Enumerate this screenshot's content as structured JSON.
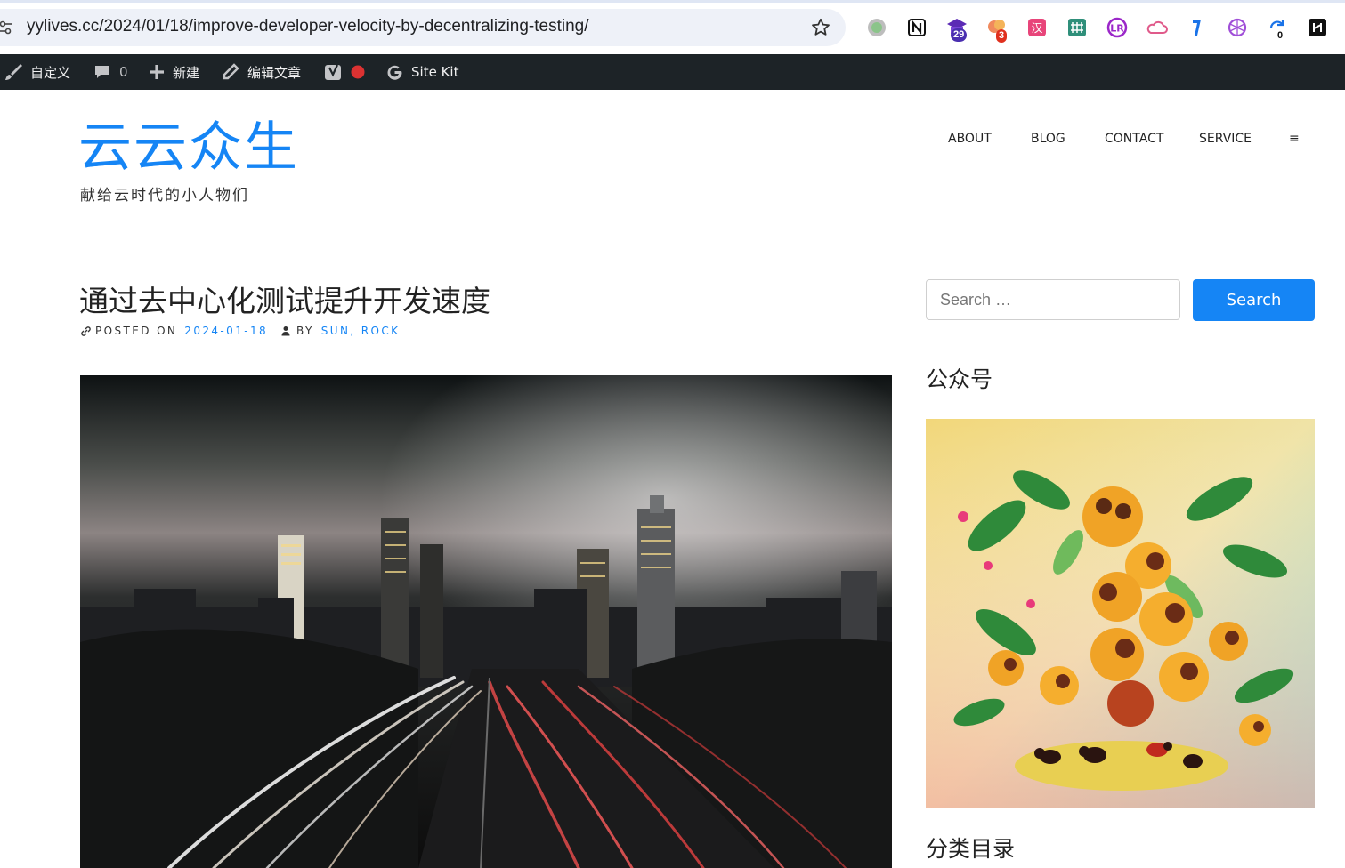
{
  "browser": {
    "url": "yylives.cc/2024/01/18/improve-developer-velocity-by-decentralizing-testing/",
    "extensions": [
      {
        "icon": "circle-extension-icon",
        "badge": ""
      },
      {
        "icon": "notion-icon",
        "badge": ""
      },
      {
        "icon": "graduation-cap-extension-icon",
        "badge": "29"
      },
      {
        "icon": "cloud-extension-icon",
        "badge": "3"
      },
      {
        "icon": "translate-extension-icon",
        "badge": ""
      },
      {
        "icon": "grid-extension-icon",
        "badge": ""
      },
      {
        "icon": "lr-extension-icon",
        "badge": ""
      },
      {
        "icon": "cloud-outline-extension-icon",
        "badge": ""
      },
      {
        "icon": "tag-extension-icon",
        "badge": ""
      },
      {
        "icon": "openai-icon",
        "badge": ""
      },
      {
        "icon": "sync-extension-icon",
        "badge": "0"
      },
      {
        "icon": "h-extension-icon",
        "badge": ""
      }
    ]
  },
  "adminbar": {
    "customize": "自定义",
    "comments_count": "0",
    "new": "新建",
    "edit_post": "编辑文章",
    "site_kit": "Site Kit"
  },
  "site": {
    "title": "云云众生",
    "description": "献给云时代的小人物们"
  },
  "nav": {
    "items": [
      "ABOUT",
      "BLOG",
      "CONTACT",
      "SERVICE"
    ],
    "menu_icon": "≡"
  },
  "post": {
    "title": "通过去中心化测试提升开发速度",
    "posted_on_label": "POSTED ON",
    "date": "2024-01-18",
    "by_label": "BY",
    "author": "SUN, ROCK"
  },
  "sidebar": {
    "search_placeholder": "Search …",
    "search_button": "Search",
    "widget1_title": "公众号",
    "widget2_title": "分类目录"
  },
  "colors": {
    "accent": "#1585f5",
    "adminbar": "#1d2327"
  }
}
